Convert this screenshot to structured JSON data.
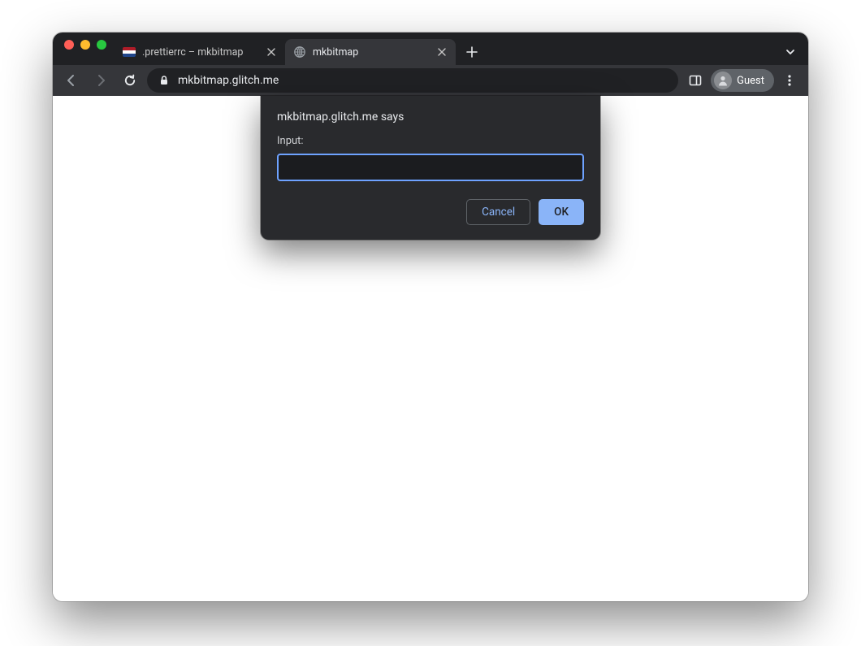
{
  "tabs": [
    {
      "title": ".prettierrc – mkbitmap",
      "active": false,
      "favicon": "flag-icon"
    },
    {
      "title": "mkbitmap",
      "active": true,
      "favicon": "globe-icon"
    }
  ],
  "addressbar": {
    "url": "mkbitmap.glitch.me"
  },
  "profile": {
    "label": "Guest"
  },
  "dialog": {
    "origin_text": "mkbitmap.glitch.me says",
    "prompt_label": "Input:",
    "input_value": "",
    "cancel_label": "Cancel",
    "ok_label": "OK"
  }
}
